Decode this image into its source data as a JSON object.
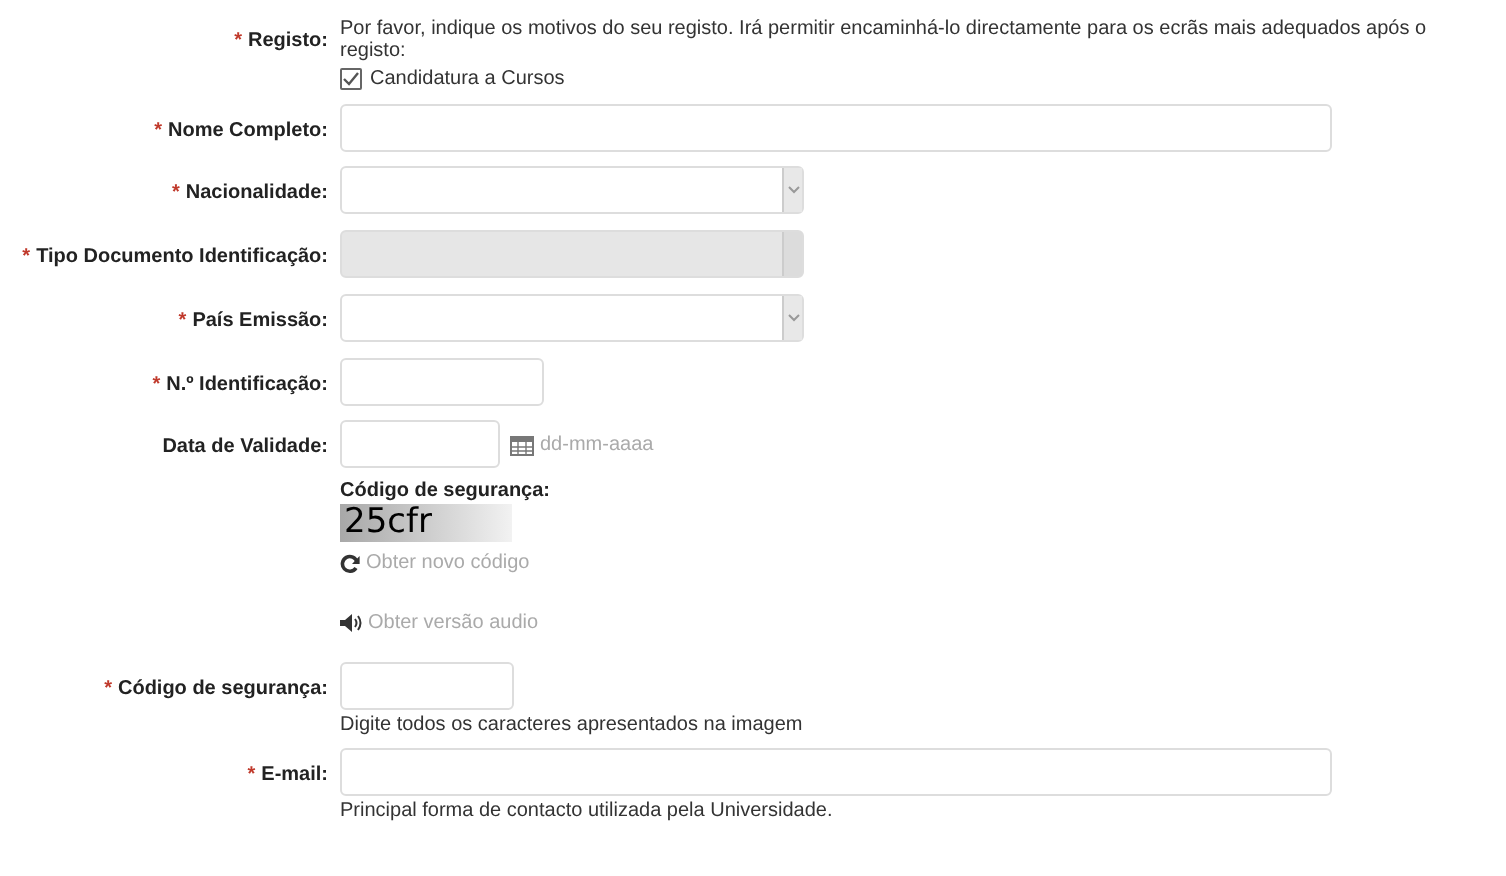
{
  "required_mark": "*",
  "rows": [
    {
      "kind": "checkboxes",
      "label": "Registo:",
      "required": true,
      "description": "Por favor, indique os motivos do seu registo. Irá permitir encaminhá-lo directamente para os ecrãs mais adequados após o registo:",
      "options": [
        {
          "label": "Candidatura a Cursos",
          "checked": true
        }
      ]
    },
    {
      "kind": "longtext",
      "label": "Nome Completo:",
      "required": true
    },
    {
      "kind": "select",
      "label": "Nacionalidade:",
      "required": true,
      "disabled": false
    },
    {
      "kind": "select",
      "label": "Tipo Documento Identificação:",
      "required": true,
      "disabled": true
    },
    {
      "kind": "select",
      "label": "País Emissão:",
      "required": true,
      "disabled": false
    },
    {
      "kind": "shorttext",
      "label": "N.º Identificação:",
      "required": true
    },
    {
      "kind": "date",
      "label": "Data de Validade:",
      "required": false,
      "hint": "dd-mm-aaaa"
    },
    {
      "kind": "captcha",
      "heading": "Código de segurança:",
      "code": "25cfr",
      "refresh": "Obter novo código",
      "audio": "Obter versão audio"
    },
    {
      "kind": "codetext",
      "label": "Código de segurança:",
      "required": true,
      "help": "Digite todos os caracteres apresentados na imagem"
    },
    {
      "kind": "longtext",
      "label": "E-mail:",
      "required": true,
      "help": "Principal forma de contacto utilizada pela Universidade."
    }
  ]
}
